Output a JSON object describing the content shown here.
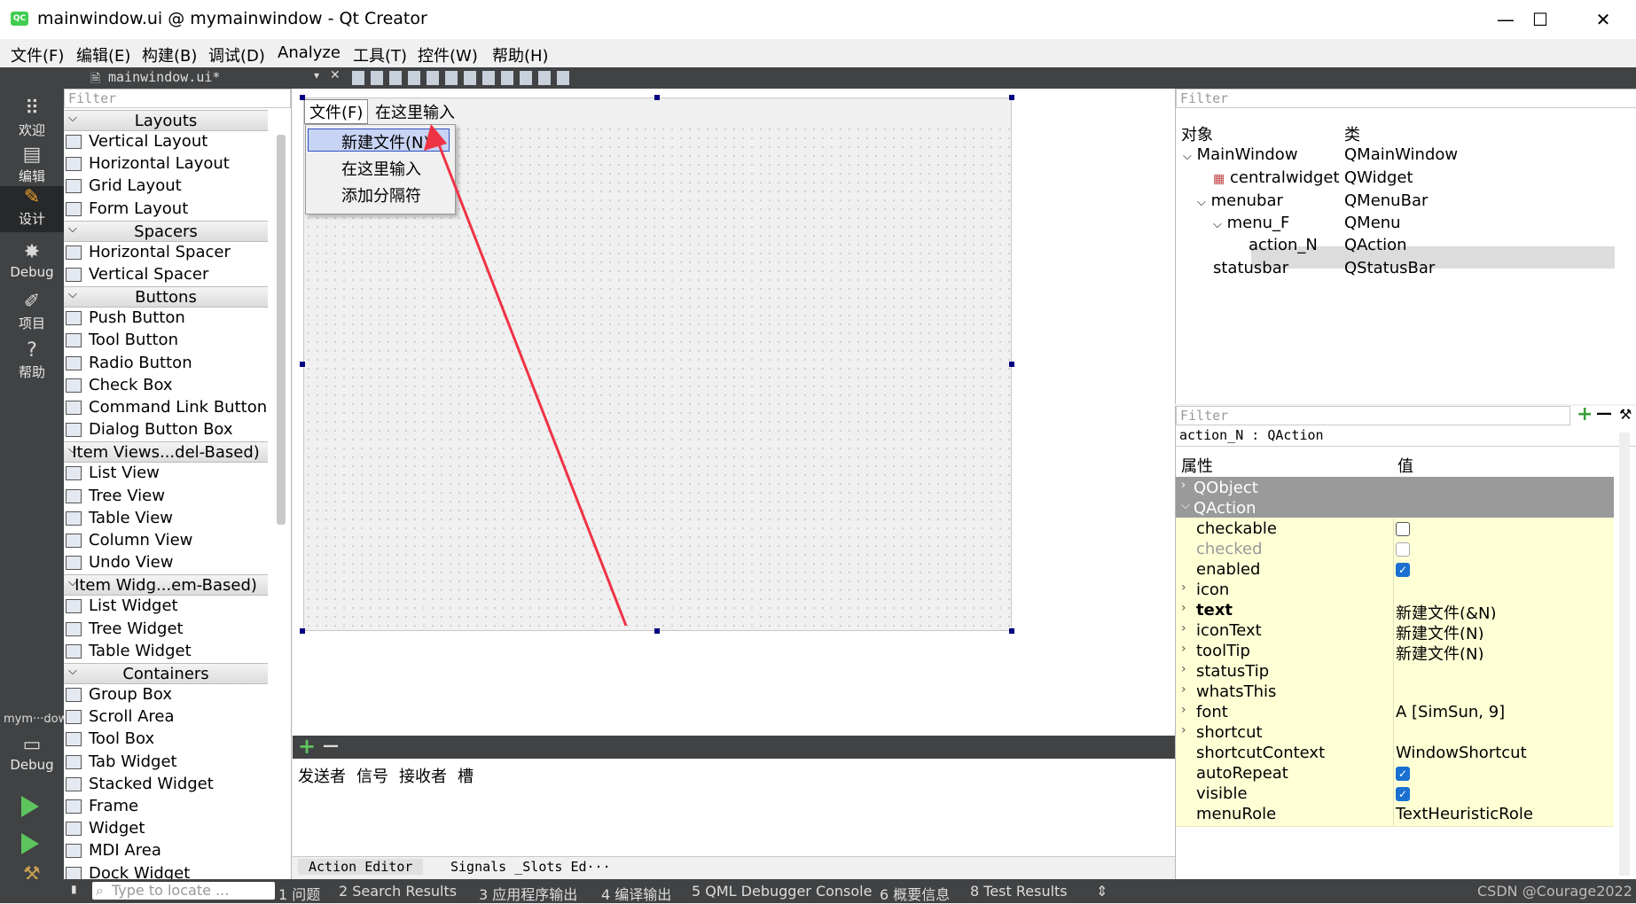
{
  "window": {
    "title": "mainwindow.ui @ mymainwindow - Qt Creator",
    "logo": "QC",
    "minimize": "—",
    "maximize": "☐",
    "close": "✕"
  },
  "menu": [
    "文件(F)",
    "编辑(E)",
    "构建(B)",
    "调试(D)",
    "Analyze",
    "工具(T)",
    "控件(W)",
    "帮助(H)"
  ],
  "modes": [
    {
      "label": "欢迎",
      "icon": "grid-icon"
    },
    {
      "label": "编辑",
      "icon": "document-icon"
    },
    {
      "label": "设计",
      "icon": "pencil-icon"
    },
    {
      "label": "Debug",
      "icon": "bug-icon"
    },
    {
      "label": "项目",
      "icon": "wrench-icon"
    },
    {
      "label": "帮助",
      "icon": "help-icon"
    }
  ],
  "kit": {
    "label": "mym···dow",
    "mode": "Debug"
  },
  "editor_tab": {
    "filename": "mainwindow.ui*"
  },
  "widget_box": {
    "filter_placeholder": "Filter",
    "categories": [
      {
        "name": "Layouts",
        "items": [
          "Vertical Layout",
          "Horizontal Layout",
          "Grid Layout",
          "Form Layout"
        ]
      },
      {
        "name": "Spacers",
        "items": [
          "Horizontal Spacer",
          "Vertical Spacer"
        ]
      },
      {
        "name": "Buttons",
        "items": [
          "Push Button",
          "Tool Button",
          "Radio Button",
          "Check Box",
          "Command Link Button",
          "Dialog Button Box"
        ]
      },
      {
        "name": "Item Views...del-Based)",
        "items": [
          "List View",
          "Tree View",
          "Table View",
          "Column View",
          "Undo View"
        ]
      },
      {
        "name": "Item Widg...em-Based)",
        "items": [
          "List Widget",
          "Tree Widget",
          "Table Widget"
        ]
      },
      {
        "name": "Containers",
        "items": [
          "Group Box",
          "Scroll Area",
          "Tool Box",
          "Tab Widget",
          "Stacked Widget",
          "Frame",
          "Widget",
          "MDI Area",
          "Dock Widget"
        ]
      }
    ]
  },
  "form": {
    "menubar": [
      "文件(F)",
      "在这里输入"
    ],
    "popup": [
      "新建文件(N)",
      "在这里输入",
      "添加分隔符"
    ]
  },
  "signal_editor": {
    "add": "+",
    "remove": "—",
    "columns": [
      "发送者",
      "信号",
      "接收者",
      "槽"
    ],
    "tabs": [
      "Action Editor",
      "Signals _Slots Ed···"
    ]
  },
  "object_inspector": {
    "filter_placeholder": "Filter",
    "headers": [
      "对象",
      "类"
    ],
    "rows": [
      {
        "name": "MainWindow",
        "class": "QMainWindow"
      },
      {
        "name": "centralwidget",
        "class": "QWidget"
      },
      {
        "name": "menubar",
        "class": "QMenuBar"
      },
      {
        "name": "menu_F",
        "class": "QMenu"
      },
      {
        "name": "action_N",
        "class": "QAction"
      },
      {
        "name": "statusbar",
        "class": "QStatusBar"
      }
    ]
  },
  "property_editor": {
    "filter_placeholder": "Filter",
    "object_label": "action_N : QAction",
    "headers": [
      "属性",
      "值"
    ],
    "groups": [
      "QObject",
      "QAction"
    ],
    "rows": [
      {
        "name": "checkable",
        "value": "",
        "check": "off"
      },
      {
        "name": "checked",
        "value": "",
        "check": "dim"
      },
      {
        "name": "enabled",
        "value": "",
        "check": "on"
      },
      {
        "name": "icon",
        "value": ""
      },
      {
        "name": "text",
        "value": "新建文件(&N)"
      },
      {
        "name": "iconText",
        "value": "新建文件(N)"
      },
      {
        "name": "toolTip",
        "value": "新建文件(N)"
      },
      {
        "name": "statusTip",
        "value": ""
      },
      {
        "name": "whatsThis",
        "value": ""
      },
      {
        "name": "font",
        "value": "A  [SimSun, 9]"
      },
      {
        "name": "shortcut",
        "value": ""
      },
      {
        "name": "shortcutContext",
        "value": "WindowShortcut"
      },
      {
        "name": "autoRepeat",
        "value": "",
        "check": "on"
      },
      {
        "name": "visible",
        "value": "",
        "check": "on"
      },
      {
        "name": "menuRole",
        "value": "TextHeuristicRole"
      }
    ]
  },
  "status_bar": {
    "locate_placeholder": "Type to locate ...",
    "items": [
      "1 问题",
      "2 Search Results",
      "3 应用程序输出",
      "4 编译输出",
      "5 QML Debugger Console",
      "6 概要信息",
      "8 Test Results"
    ],
    "watermark": "CSDN @Courage2022"
  },
  "colors": {
    "accent": "#41cd52",
    "sidebar": "#404244",
    "selection": "#000080",
    "property_row": "#ffffd6",
    "arrow": "#ee3344"
  }
}
